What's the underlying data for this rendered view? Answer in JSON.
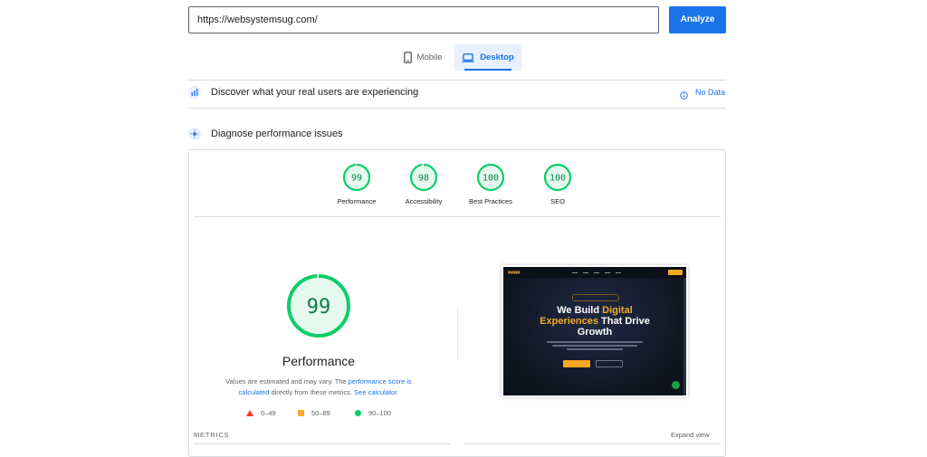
{
  "search": {
    "url": "https://websystemsug.com/",
    "analyze_label": "Analyze"
  },
  "tabs": {
    "mobile": "Mobile",
    "desktop": "Desktop",
    "selected": "desktop"
  },
  "field_data": {
    "title": "Discover what your real users are experiencing",
    "status": "No Data"
  },
  "lab": {
    "title": "Diagnose performance issues"
  },
  "scores": [
    {
      "label": "Performance",
      "value": "99",
      "fraction": 0.99
    },
    {
      "label": "Accessibility",
      "value": "98",
      "fraction": 0.98
    },
    {
      "label": "Best Practices",
      "value": "100",
      "fraction": 1.0
    },
    {
      "label": "SEO",
      "value": "100",
      "fraction": 1.0
    }
  ],
  "performance": {
    "score": "99",
    "fraction": 0.99,
    "title": "Performance",
    "note_prefix": "Values are estimated and may vary. The ",
    "note_link1": "performance score is calculated",
    "note_middle": " directly from these metrics. ",
    "note_link2": "See calculator."
  },
  "legend": {
    "poor": "0–49",
    "average": "50–89",
    "good": "90–100"
  },
  "metrics": {
    "label": "METRICS",
    "expand": "Expand view"
  },
  "thumbnail": {
    "headline_1": "We Build ",
    "headline_1_accent": "Digital",
    "headline_2_accent": "Experiences",
    "headline_2": " That Drive",
    "headline_3": "Growth"
  },
  "colors": {
    "good": "#0cce6b",
    "accent": "#1a73e8",
    "poor": "#ff3333",
    "average": "#ffaa33"
  }
}
